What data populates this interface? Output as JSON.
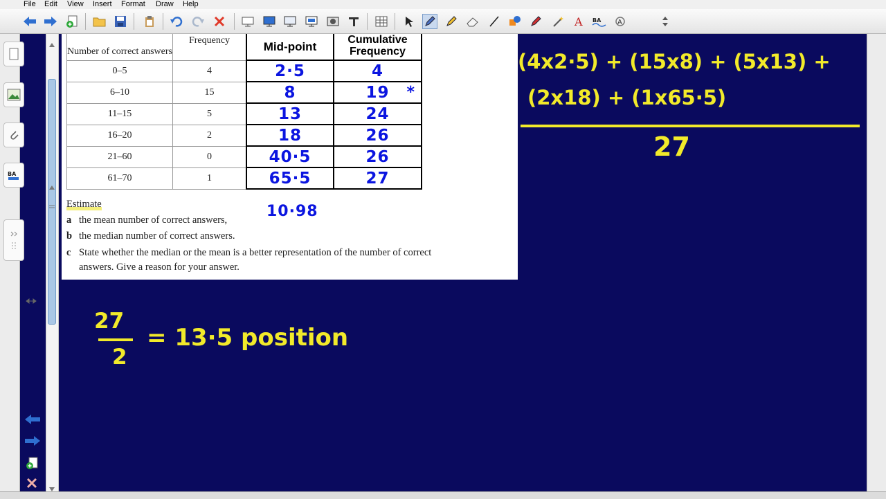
{
  "menu": [
    "File",
    "Edit",
    "View",
    "Insert",
    "Format",
    "Draw",
    "Help"
  ],
  "table": {
    "headers": [
      "Number of correct answers",
      "Frequency",
      "Mid-point",
      "Cumulative Frequency"
    ],
    "rows": [
      {
        "range": "0–5",
        "freq": "4",
        "mid": "2·5",
        "cum": "4"
      },
      {
        "range": "6–10",
        "freq": "15",
        "mid": "8",
        "cum": "19"
      },
      {
        "range": "11–15",
        "freq": "5",
        "mid": "13",
        "cum": "24"
      },
      {
        "range": "16–20",
        "freq": "2",
        "mid": "18",
        "cum": "26"
      },
      {
        "range": "21–60",
        "freq": "0",
        "mid": "40·5",
        "cum": "26"
      },
      {
        "range": "61–70",
        "freq": "1",
        "mid": "65·5",
        "cum": "27"
      }
    ],
    "star_mark": "*"
  },
  "questions": {
    "estimate": "Estimate",
    "a_label": "a",
    "a_text": "the mean number of correct answers,",
    "b_label": "b",
    "b_text": "the median number of correct answers.",
    "c_label": "c",
    "c_text_1": "State whether the median or the mean is a better representation of the number of correct",
    "c_text_2": "answers. Give a reason for your answer.",
    "mean_answer": "10·98"
  },
  "annotations": {
    "mean_line1": "(4x2·5) + (15x8) + (5x13) +",
    "mean_line2": "(2x18) + (1x65·5)",
    "mean_denominator": "27",
    "median_numerator": "27",
    "median_denominator": "2",
    "median_result": "= 13·5 position"
  },
  "colors": {
    "board": "#0a0a5e",
    "ink_blue": "#0b15e0",
    "ink_yellow": "#f2ea2a"
  }
}
